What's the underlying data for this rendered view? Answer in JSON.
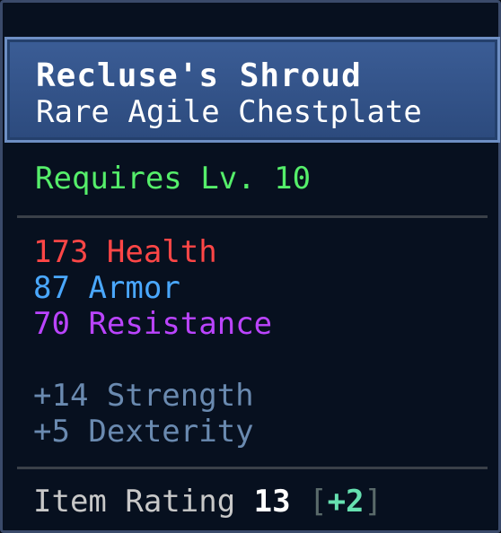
{
  "item": {
    "name": "Recluse's Shroud",
    "type": "Rare Agile Chestplate",
    "requirement": "Requires Lv. 10"
  },
  "stats": {
    "health_value": "173",
    "health_label": "Health",
    "armor_value": "87",
    "armor_label": "Armor",
    "resistance_value": "70",
    "resistance_label": "Resistance"
  },
  "attributes": {
    "strength": "+14 Strength",
    "dexterity": "+5 Dexterity"
  },
  "rating": {
    "label": "Item Rating",
    "value": "13",
    "bracket_open": "[",
    "bonus": "+2",
    "bracket_close": "]"
  },
  "colors": {
    "header_bg": "#2c4a7d",
    "requirement": "#55ee6a",
    "health": "#ff4646",
    "armor": "#4aa8ff",
    "resistance": "#bb44ff",
    "bonus": "#66e0b0"
  }
}
